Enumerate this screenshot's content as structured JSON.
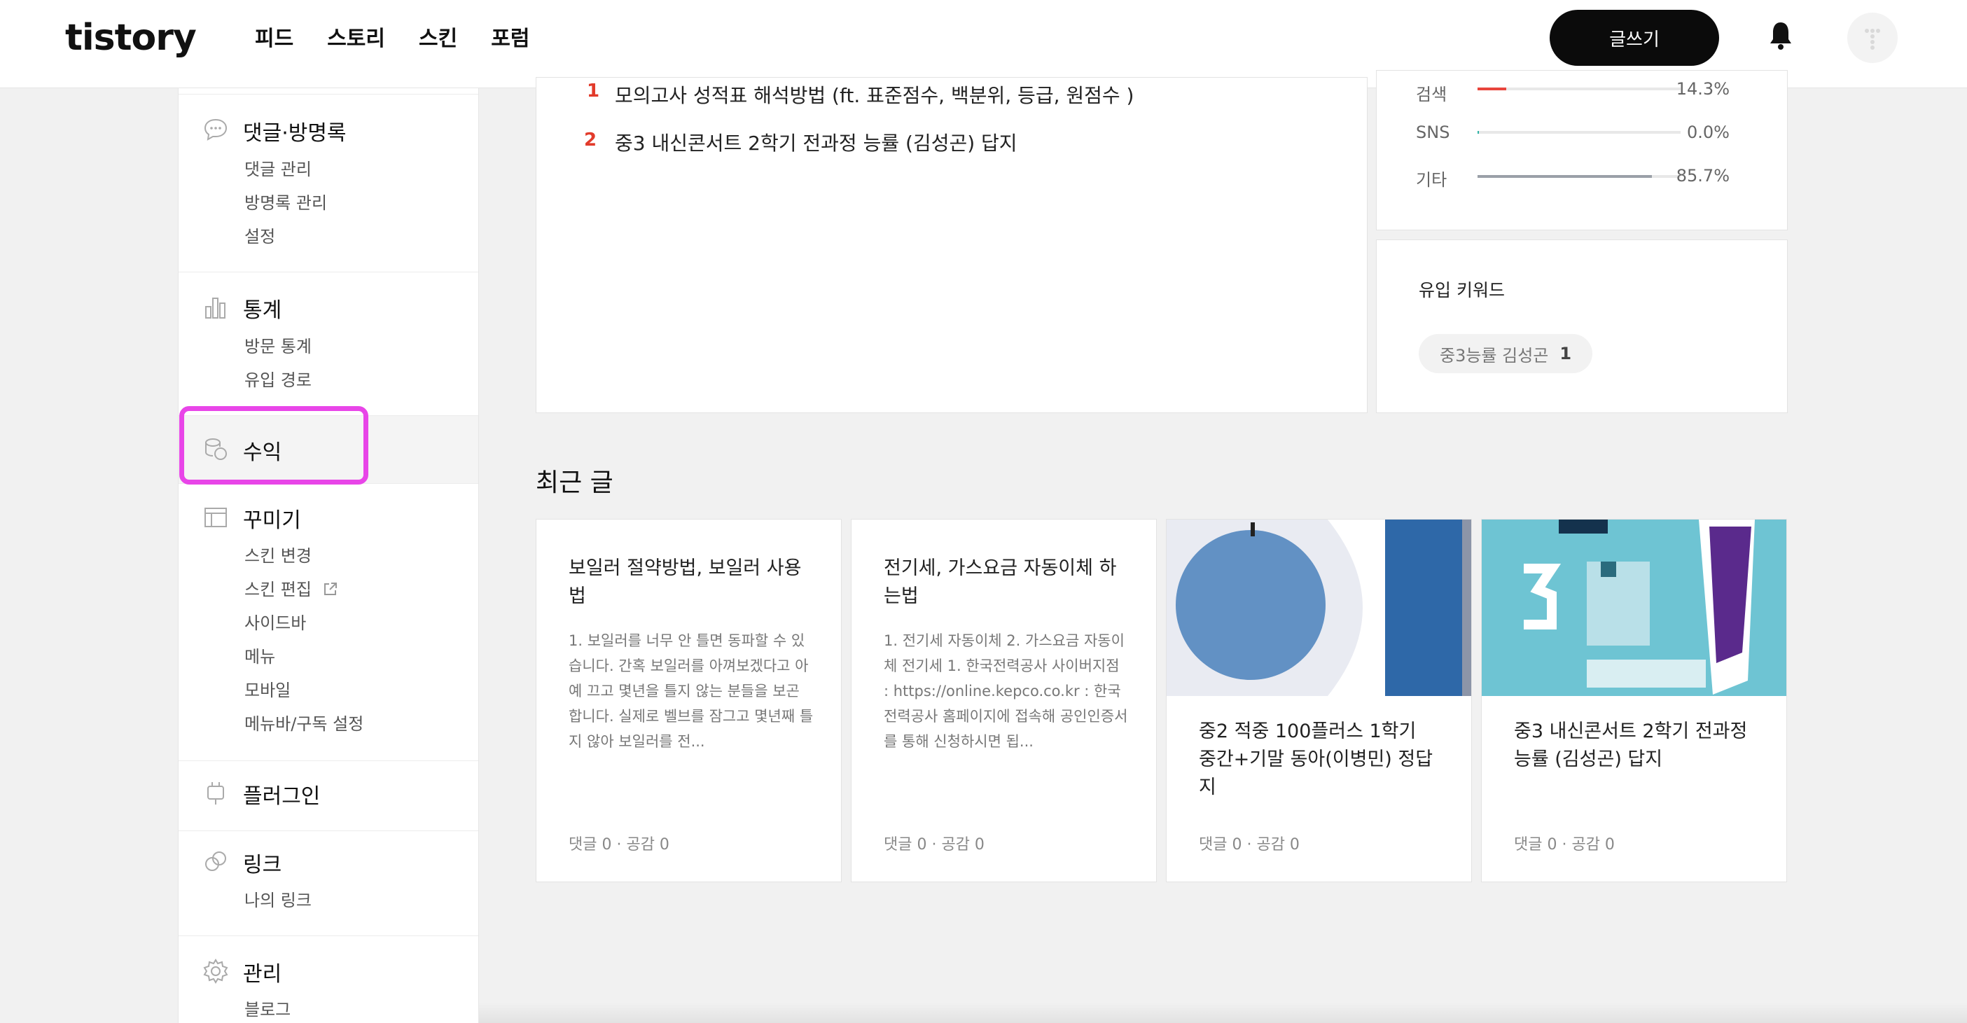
{
  "header": {
    "logo": "tistory",
    "nav": [
      "피드",
      "스토리",
      "스킨",
      "포럼"
    ],
    "write_label": "글쓰기"
  },
  "sidebar": {
    "comments": {
      "title": "댓글·방명록",
      "items": [
        "댓글 관리",
        "방명록 관리",
        "설정"
      ]
    },
    "stats": {
      "title": "통계",
      "items": [
        "방문 통계",
        "유입 경로"
      ]
    },
    "revenue": {
      "title": "수익"
    },
    "decorate": {
      "title": "꾸미기",
      "items": [
        "스킨 변경",
        "스킨 편집",
        "사이드바",
        "메뉴",
        "모바일",
        "메뉴바/구독 설정"
      ]
    },
    "plugin": {
      "title": "플러그인"
    },
    "link": {
      "title": "링크",
      "items": [
        "나의 링크"
      ]
    },
    "manage": {
      "title": "관리",
      "items": [
        "블로그"
      ]
    }
  },
  "popular_posts": [
    {
      "rank": "1",
      "title": "모의고사 성적표 해석방법 (ft. 표준점수, 백분위, 등급, 원점수 )"
    },
    {
      "rank": "2",
      "title": "중3 내신콘서트 2학기 전과정 능률 (김성곤) 답지"
    }
  ],
  "referrers": [
    {
      "label": "검색",
      "pct": "14.3%",
      "value": 14.3
    },
    {
      "label": "SNS",
      "pct": "0.0%",
      "value": 0.0
    },
    {
      "label": "기타",
      "pct": "85.7%",
      "value": 85.7
    }
  ],
  "keywords": {
    "title": "유입 키워드",
    "items": [
      {
        "keyword": "중3능률 김성곤",
        "count": "1"
      }
    ]
  },
  "recent": {
    "title": "최근 글",
    "cards": [
      {
        "title": "보일러 절약방법, 보일러 사용법",
        "body": "1. 보일러를 너무 안 틀면 동파할 수 있습니다. 간혹 보일러를 아껴보겠다고 아예 끄고 몇년을 틀지 않는 분들을 보곤 합니다. 실제로 벨브를 잠그고 몇년째 틀지 않아 보일러를 전...",
        "meta": "댓글 0 · 공감 0"
      },
      {
        "title": "전기세, 가스요금 자동이체 하는법",
        "body": "1. 전기세 자동이체 2. 가스요금 자동이체 전기세 1. 한국전력공사 사이버지점 : https://online.kepco.co.kr : 한국전력공사 홈페이지에 접속해 공인인증서를 통해 신청하시면 됩...",
        "meta": "댓글 0 · 공감 0"
      },
      {
        "title": "중2 적중 100플러스 1학기 중간+기말 동아(이병민) 정답지",
        "meta": "댓글 0 · 공감 0"
      },
      {
        "title": "중3 내신콘서트 2학기 전과정 능률 (김성곤) 답지",
        "meta": "댓글 0 · 공감 0"
      }
    ]
  },
  "colors": {
    "highlight": "#e845e8",
    "rank": "#e23b2b",
    "accent": "#0b0b0b"
  }
}
